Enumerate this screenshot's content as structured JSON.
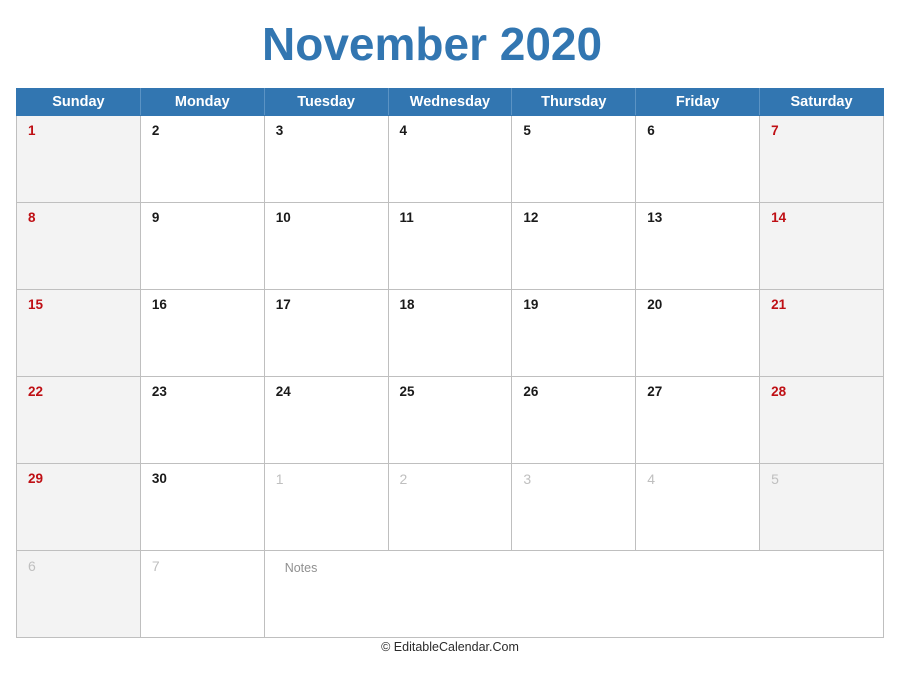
{
  "title": "November 2020",
  "weekday_headers": [
    "Sunday",
    "Monday",
    "Tuesday",
    "Wednesday",
    "Thursday",
    "Friday",
    "Saturday"
  ],
  "notes_label": "Notes",
  "footer": "© EditableCalendar.Com",
  "colors": {
    "header_blue": "#3276b1",
    "title_blue": "#3276b1",
    "weekend_red": "#bf0f14",
    "weekend_bg": "#f3f3f3",
    "muted_gray": "#bfbfbf",
    "grid_line": "#bfbfbf"
  },
  "weeks": [
    [
      {
        "day": "1",
        "style": "red"
      },
      {
        "day": "2",
        "style": "normal"
      },
      {
        "day": "3",
        "style": "normal"
      },
      {
        "day": "4",
        "style": "normal"
      },
      {
        "day": "5",
        "style": "normal"
      },
      {
        "day": "6",
        "style": "normal"
      },
      {
        "day": "7",
        "style": "red"
      }
    ],
    [
      {
        "day": "8",
        "style": "red"
      },
      {
        "day": "9",
        "style": "normal"
      },
      {
        "day": "10",
        "style": "normal"
      },
      {
        "day": "11",
        "style": "normal"
      },
      {
        "day": "12",
        "style": "normal"
      },
      {
        "day": "13",
        "style": "normal"
      },
      {
        "day": "14",
        "style": "red"
      }
    ],
    [
      {
        "day": "15",
        "style": "red"
      },
      {
        "day": "16",
        "style": "normal"
      },
      {
        "day": "17",
        "style": "normal"
      },
      {
        "day": "18",
        "style": "normal"
      },
      {
        "day": "19",
        "style": "normal"
      },
      {
        "day": "20",
        "style": "normal"
      },
      {
        "day": "21",
        "style": "red"
      }
    ],
    [
      {
        "day": "22",
        "style": "red"
      },
      {
        "day": "23",
        "style": "normal"
      },
      {
        "day": "24",
        "style": "normal"
      },
      {
        "day": "25",
        "style": "normal"
      },
      {
        "day": "26",
        "style": "normal"
      },
      {
        "day": "27",
        "style": "normal"
      },
      {
        "day": "28",
        "style": "red"
      }
    ],
    [
      {
        "day": "29",
        "style": "red"
      },
      {
        "day": "30",
        "style": "normal"
      },
      {
        "day": "1",
        "style": "muted"
      },
      {
        "day": "2",
        "style": "muted"
      },
      {
        "day": "3",
        "style": "muted"
      },
      {
        "day": "4",
        "style": "muted"
      },
      {
        "day": "5",
        "style": "muted"
      }
    ]
  ],
  "last_row": [
    {
      "day": "6",
      "style": "muted"
    },
    {
      "day": "7",
      "style": "muted"
    }
  ]
}
